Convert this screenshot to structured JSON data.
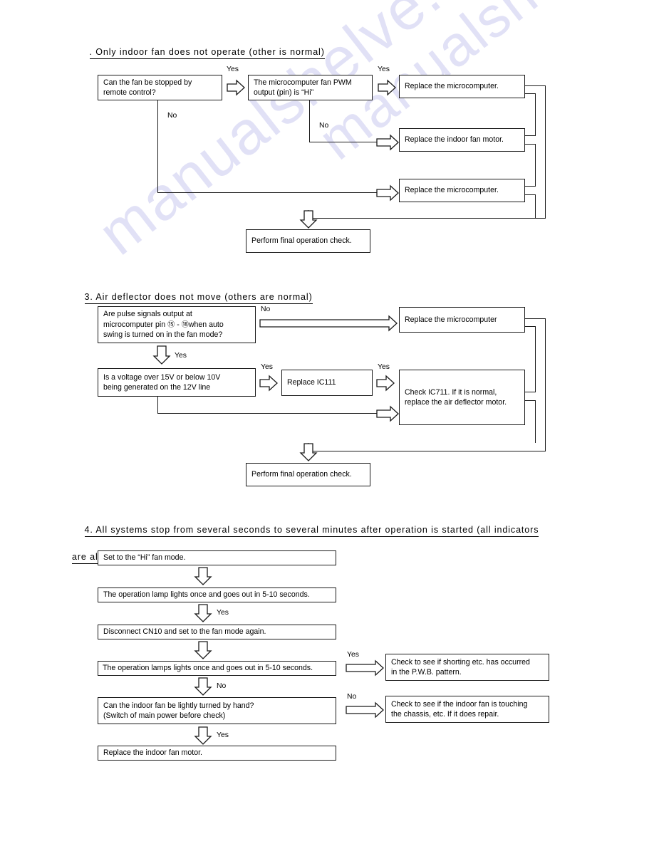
{
  "watermark": {
    "line1": "manualshelve.com",
    "line2": "manualshelve.com"
  },
  "sections": {
    "sec2": {
      "heading": ". Only indoor fan does not operate (other is normal)",
      "boxes": {
        "q1": "Can the fan be stopped by\nremote control?",
        "q2": "The microcomputer fan PWM\noutput (pin) is “Hi”",
        "r1": "Replace the microcomputer.",
        "r2": "Replace the indoor fan motor.",
        "r3": "Replace the microcomputer.",
        "final": "Perform final operation check."
      },
      "labels": {
        "yes1": "Yes",
        "yes2": "Yes",
        "no1": "No",
        "no2": "No"
      }
    },
    "sec3": {
      "heading": "3. Air deflector does not move (others are normal)",
      "boxes": {
        "q1_line1": "Are pulse signals output at",
        "q1_line2_a": "microcomputer pin ",
        "q1_pin_from": "⑮",
        "q1_pin_dash": " - ",
        "q1_pin_to": "⑱",
        "q1_line2_b": "when auto",
        "q1_line3": "swing is turned on in the fan mode?",
        "q2": "Is a voltage over 15V or below 10V\nbeing generated on the 12V line",
        "r_ic111": "Replace IC111",
        "r_micro": "Replace the microcomputer",
        "r_ic711": "Check IC711. If it is normal,\nreplace the air deflector motor.",
        "final": "Perform final operation check."
      },
      "labels": {
        "no1": "No",
        "yes_down": "Yes",
        "yes1": "Yes",
        "yes2": "Yes"
      }
    },
    "sec4": {
      "heading_line1": "4. All systems stop from several seconds to several minutes after operation is started (all indicators",
      "heading_line2": "are also off)",
      "boxes": {
        "s1": "Set to the “Hi” fan mode.",
        "s2": "The operation lamp lights once and goes out in 5-10 seconds.",
        "s3": "Disconnect CN10 and set to the fan mode again.",
        "s4": "The operation lamps lights once and goes out in 5-10 seconds.",
        "s5": "Can the indoor fan be lightly turned by hand?\n(Switch of main power before check)",
        "s6": "Replace the indoor fan motor.",
        "r1": "Check to see if shorting etc. has occurred\nin the P.W.B. pattern.",
        "r2": "Check to see if the indoor fan is touching\nthe chassis, etc. If it does repair."
      },
      "labels": {
        "yes1": "Yes",
        "no1": "No",
        "yes2": "Yes",
        "yes_right": "Yes",
        "no_right": "No"
      }
    }
  }
}
